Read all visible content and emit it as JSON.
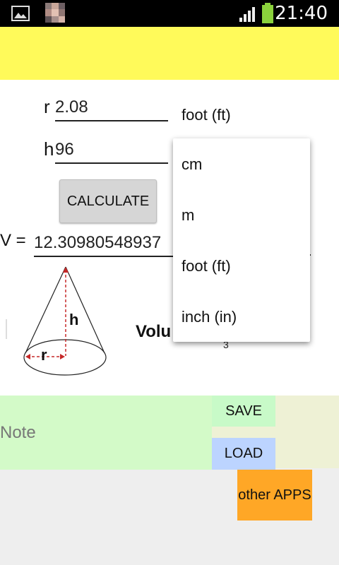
{
  "status_bar": {
    "time": "21:40",
    "icons": [
      "image-icon",
      "app-thumbnail-icon",
      "signal-icon",
      "battery-icon"
    ]
  },
  "form": {
    "r_label": "r",
    "r_value": "2.08",
    "r_unit": "foot (ft)",
    "h_label": "h",
    "h_value": "96",
    "calculate_label": "CALCULATE",
    "v_label": "V =",
    "v_value": "12.30980548937"
  },
  "diagram": {
    "h_label": "h",
    "r_label": "r",
    "volume_text": "Volu",
    "superscript": "3"
  },
  "dropdown": {
    "options": [
      "cm",
      "m",
      "foot (ft)",
      "inch (in)"
    ]
  },
  "bottom": {
    "note_placeholder": "Note",
    "save_label": "SAVE",
    "load_label": "LOAD",
    "other_apps_label": "other APPS"
  },
  "colors": {
    "banner": "#fffa5a",
    "note_bg": "#d3fac8",
    "save_bg": "#c8fac8",
    "load_bg": "#bcd4ff",
    "apps_bg": "#ffa726"
  }
}
